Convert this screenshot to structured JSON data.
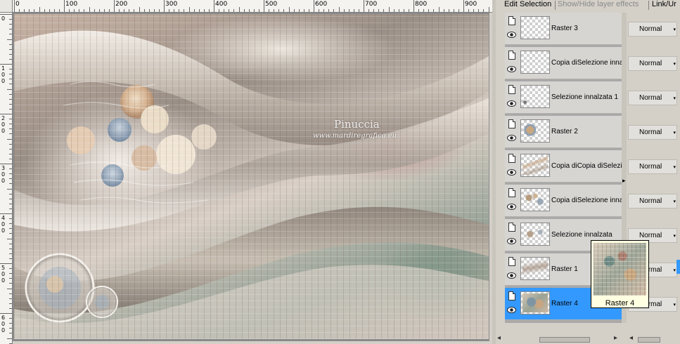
{
  "ruler": {
    "top_labels": [
      "0",
      "100",
      "200",
      "300",
      "400",
      "500",
      "600",
      "700",
      "800",
      "900"
    ],
    "left_labels": [
      "0",
      "100",
      "200",
      "300",
      "400",
      "500",
      "600"
    ]
  },
  "canvas": {
    "watermark_title": "Pinuccia",
    "watermark_url": "www.mardiregrafica.eu",
    "colors": {
      "warm": "#c8b3a5",
      "rose": "#b98f8c",
      "sage": "#8f9d91",
      "cream": "#f2ece6"
    }
  },
  "layers_panel": {
    "toolbar": {
      "edit_selection": "Edit Selection",
      "show_hide_effects": "Show/Hide layer effects",
      "link": "Link/Ur"
    },
    "layers": [
      {
        "name": "Raster 3",
        "blend_mode": "Normal",
        "selected": false,
        "visible": true
      },
      {
        "name": "Copia diSelezione innalz.",
        "blend_mode": "Normal",
        "selected": false,
        "visible": true
      },
      {
        "name": "Selezione innalzata 1",
        "blend_mode": "Normal",
        "selected": false,
        "visible": true
      },
      {
        "name": "Raster 2",
        "blend_mode": "Normal",
        "selected": false,
        "visible": true
      },
      {
        "name": "Copia diCopia diSelezion",
        "blend_mode": "Normal",
        "selected": false,
        "visible": true
      },
      {
        "name": "Copia diSelezione innalz.",
        "blend_mode": "Normal",
        "selected": false,
        "visible": true
      },
      {
        "name": "Selezione innalzata",
        "blend_mode": "Normal",
        "selected": false,
        "visible": true
      },
      {
        "name": "Raster 1",
        "blend_mode": "Normal",
        "selected": false,
        "visible": true
      },
      {
        "name": "Raster 4",
        "blend_mode": "Normal",
        "selected": true,
        "visible": true
      }
    ],
    "selection_color": "#3399ff",
    "tooltip": {
      "label": "Raster 4"
    }
  },
  "icons": {
    "visibility": "eye-icon",
    "layer_type": "document-icon",
    "expand": "triangle-right-icon"
  }
}
